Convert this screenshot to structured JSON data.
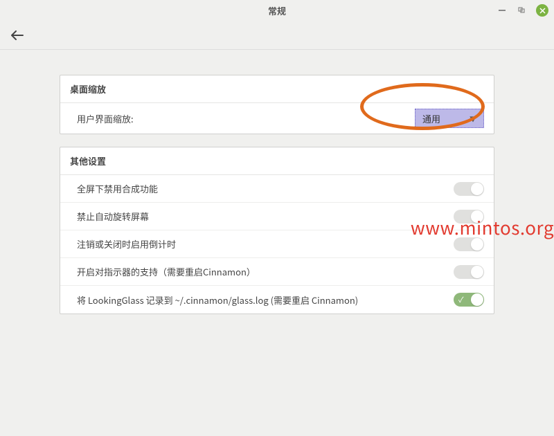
{
  "window": {
    "title": "常规"
  },
  "sections": {
    "scaling": {
      "header": "桌面缩放",
      "row_label": "用户界面缩放:",
      "dropdown_value": "通用"
    },
    "other": {
      "header": "其他设置",
      "rows": [
        {
          "label": "全屏下禁用合成功能",
          "on": false
        },
        {
          "label": "禁止自动旋转屏幕",
          "on": false
        },
        {
          "label": "注销或关闭时启用倒计时",
          "on": false
        },
        {
          "label": "开启对指示器的支持（需要重启Cinnamon）",
          "on": false
        },
        {
          "label": "将 LookingGlass 记录到 ~/.cinnamon/glass.log (需要重启 Cinnamon)",
          "on": true
        }
      ]
    }
  },
  "watermark": "www.mintos.org"
}
